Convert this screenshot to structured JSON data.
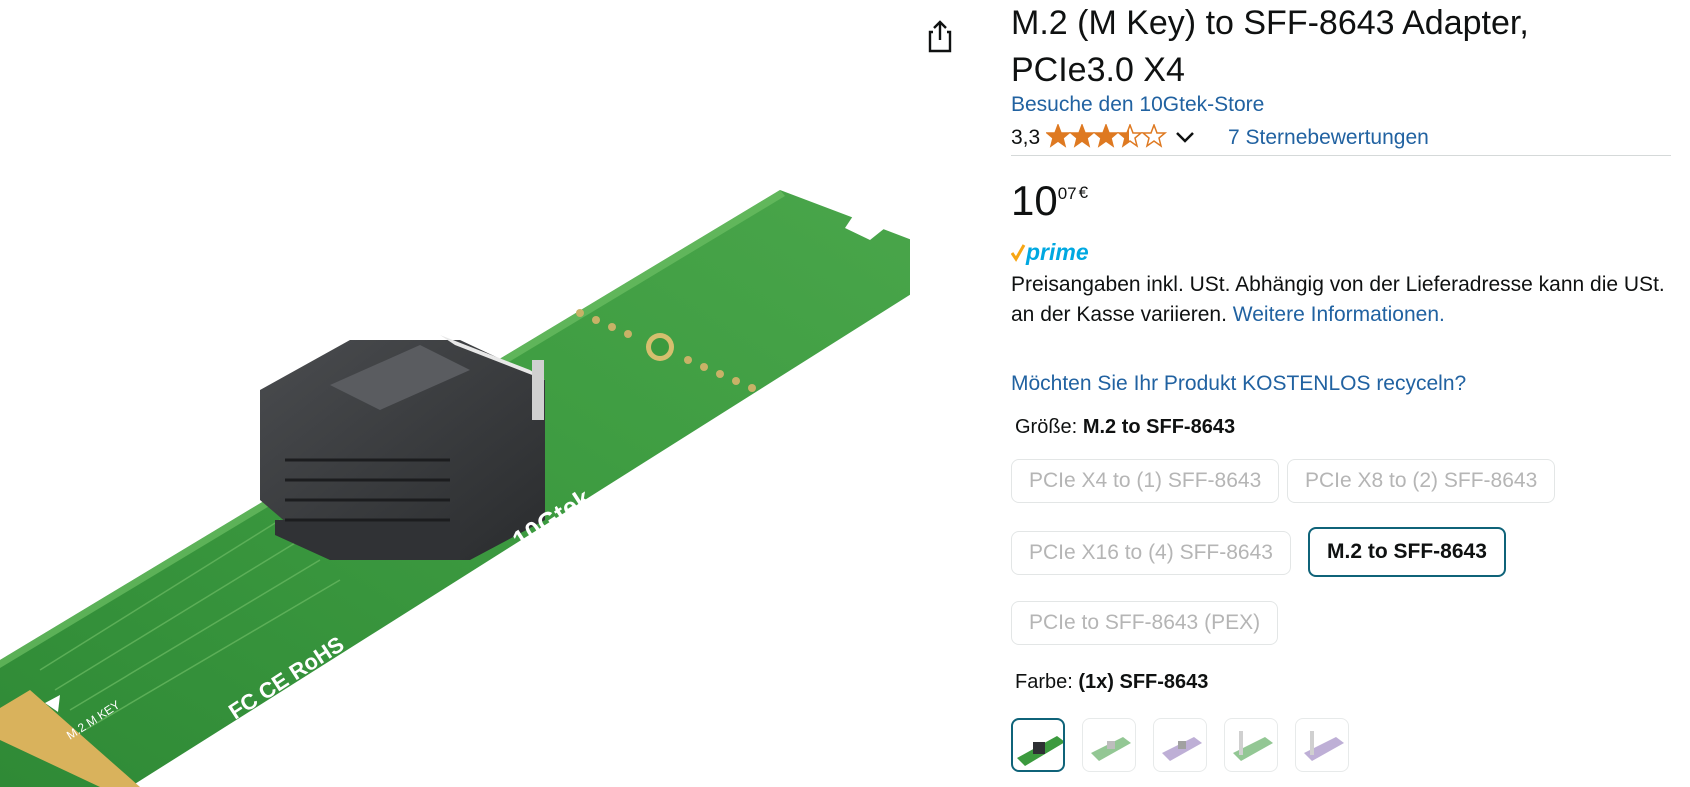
{
  "product": {
    "title": "M.2 (M Key) to SFF-8643 Adapter, PCIe3.0 X4",
    "store_link": "Besuche den 10Gtek-Store",
    "rating_value": "3,3",
    "rating_stars": 3.3,
    "ratings_count_label": "7 Sternebewertungen",
    "price": {
      "whole": "10",
      "fraction": "07",
      "currency": "€"
    },
    "prime_label": "prime",
    "tax_text": "Preisangaben inkl. USt. Abhängig von der Lieferadresse kann die USt. an der Kasse variieren.",
    "tax_link": "Weitere Informationen.",
    "recycle_link": "Möchten Sie Ihr Produkt KOSTENLOS recyceln?"
  },
  "size": {
    "label": "Größe:",
    "selected": "M.2 to SFF-8643",
    "options": [
      "PCIe X4 to (1) SFF-8643",
      "PCIe X8 to (2) SFF-8643",
      "PCIe X16 to (4) SFF-8643",
      "M.2 to SFF-8643",
      "PCIe to SFF-8643 (PEX)"
    ]
  },
  "color": {
    "label": "Farbe:",
    "selected": "(1x) SFF-8643"
  },
  "image_text": {
    "brand": "10Gtek",
    "marks": "FC CE RoHS",
    "key": "M.2 M KEY"
  },
  "colors": {
    "link": "#2162a1",
    "selected_border": "#0f6379",
    "star": "#de7921",
    "prime": "#00a8e1",
    "prime_check": "#f7a614",
    "pcb": "#3c9a3e"
  }
}
